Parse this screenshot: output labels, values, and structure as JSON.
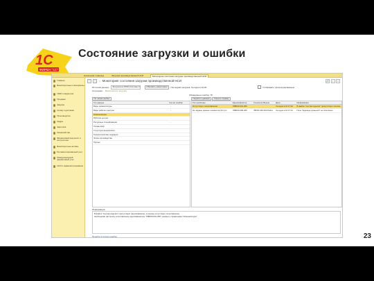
{
  "slide": {
    "title": "Состояние загрузки и ошибки",
    "page_number": "23",
    "logo": {
      "brand_text": "1С",
      "sub_text": "ФИРМА \"1С\"",
      "colors": {
        "yellow": "#f7d21b",
        "red": "#d9251c"
      }
    }
  },
  "app": {
    "tabs": [
      {
        "label": "Начальная страница",
        "active": false
      },
      {
        "label": "Загрузка производственной НСИ",
        "active": false
      },
      {
        "label": "Мониторинг состояния загрузки производственной НСИ",
        "active": true
      }
    ],
    "sidebar": [
      {
        "icon": "nav-icon",
        "label": "Главное"
      },
      {
        "icon": "nav-icon",
        "label": "Внеоборотные и материалы"
      },
      {
        "icon": "nav-icon",
        "label": "CRM и маркетинг"
      },
      {
        "icon": "nav-icon",
        "label": "Продажи"
      },
      {
        "icon": "nav-icon",
        "label": "Закупки"
      },
      {
        "icon": "nav-icon",
        "label": "Склад и доставка"
      },
      {
        "icon": "nav-icon",
        "label": "Производство"
      },
      {
        "icon": "nav-icon",
        "label": "Кадры"
      },
      {
        "icon": "nav-icon",
        "label": "Зарплата"
      },
      {
        "icon": "nav-icon",
        "label": "Казначейство"
      },
      {
        "icon": "nav-icon",
        "label": "Финансовый результат и контроллинг"
      },
      {
        "icon": "nav-icon",
        "label": "Внеоборотные активы"
      },
      {
        "icon": "nav-icon",
        "label": "Регламентированный учет"
      },
      {
        "icon": "nav-icon",
        "label": "Международный финансовый учет"
      },
      {
        "icon": "nav-icon",
        "label": "НСИ и администрирование"
      }
    ],
    "main": {
      "title": "Мониторинг состояния загрузки производственной НСИ",
      "source_label": "Источник данных:",
      "source_value": "Загрузка из PDM-Системы С",
      "refresh_button": "Обновить мониторинг",
      "last_load": "Последняя загрузка: Сегодня в 10:00",
      "show_processed": "Отображать проигнорированные",
      "status_label": "Состояние:",
      "status_value": "Выполняется загрузка",
      "errors_label": "Обнаружено ошибок: 75",
      "left_toolbar": [
        "По типам ошибок"
      ],
      "right_toolbar": [
        "Перейти к данным",
        "Открыть справку"
      ],
      "left_headers": [
        "Тип данных",
        "Кол-во ошибок"
      ],
      "left_rows": [
        {
          "name": "Виды номенклатуры",
          "count": "",
          "selected": false
        },
        {
          "name": "Виды рабочих центров",
          "count": "",
          "selected": false
        },
        {
          "name": "Номенклатура",
          "count": "",
          "selected": true
        },
        {
          "name": "Рабочие центры",
          "count": "",
          "selected": false
        },
        {
          "name": "Ресурсные спецификации",
          "count": "",
          "selected": false
        },
        {
          "name": "Схемы вкар",
          "count": "",
          "selected": false
        },
        {
          "name": "Структура предприятия",
          "count": "",
          "selected": false
        },
        {
          "name": "Технологические операции",
          "count": "",
          "selected": false
        },
        {
          "name": "Этапы производства",
          "count": "",
          "selected": false
        },
        {
          "name": "Прочее",
          "count": "",
          "selected": false
        }
      ],
      "right_headers": [
        "Тип проблемы",
        "Идентификатор",
        "Ссылка во Внешн",
        "Дата",
        "Информация"
      ],
      "right_rows": [
        {
          "type": "Отсутствует сопоставление",
          "id": "78BF00-001-456",
          "link": "",
          "date": "Сегодня в 10:17:42",
          "info": "В файле \"Состав изделия\" присутствует ссылка...",
          "selected": true
        },
        {
          "type": "Не заданы данные элементов (Отсутс",
          "id": "78BF00-098-465",
          "link": "7BF00-000-000 Рейсе",
          "date": "Сегодня в 10:17:41",
          "info": "Поле \"Единица хранения\" не заполнено",
          "selected": false
        }
      ],
      "info_label": "Информация:",
      "info_lines": [
        "В файле \"Состав изделия\" присутствует идентификатор, которому отсутствует сопоставление.",
        "Необходимо настроить сопоставление идентификатора \"78BF00-001-456\" элементу справочника \"Номенклатура\""
      ],
      "footer_link": "Перейти в список ошибок"
    }
  }
}
